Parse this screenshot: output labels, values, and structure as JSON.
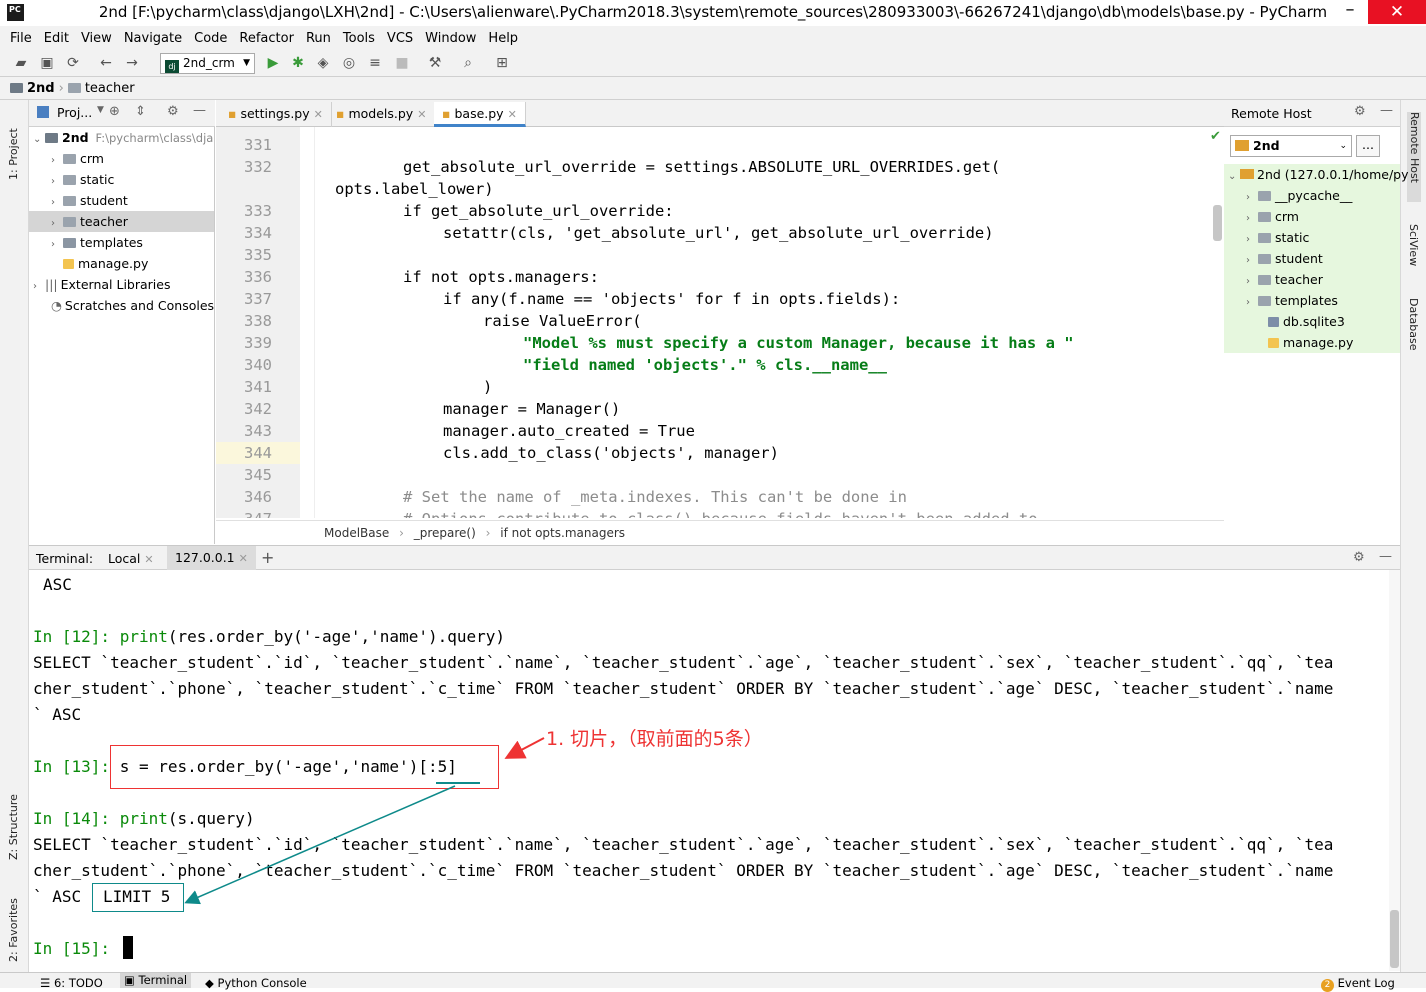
{
  "window": {
    "title": "2nd [F:\\pycharm\\class\\django\\LXH\\2nd] - C:\\Users\\alienware\\.PyCharm2018.3\\system\\remote_sources\\280933003\\-66267241\\django\\db\\models\\base.py - PyCharm",
    "app_icon_text": "PC"
  },
  "menu": [
    "File",
    "Edit",
    "View",
    "Navigate",
    "Code",
    "Refactor",
    "Run",
    "Tools",
    "VCS",
    "Window",
    "Help"
  ],
  "toolbar": {
    "run_config": "2nd_crm"
  },
  "navbar": {
    "project": "2nd",
    "folder": "teacher"
  },
  "left_stripe": {
    "project": "1: Project",
    "structure": "Z: Structure",
    "favorites": "2: Favorites"
  },
  "right_stripe": {
    "remote_host": "Remote Host",
    "sciview": "SciView",
    "database": "Database"
  },
  "project_panel": {
    "title": "Proj...",
    "root": {
      "name": "2nd",
      "path": "F:\\pycharm\\class\\dja"
    },
    "items": [
      {
        "name": "crm"
      },
      {
        "name": "static"
      },
      {
        "name": "student"
      },
      {
        "name": "teacher"
      },
      {
        "name": "templates"
      },
      {
        "name": "manage.py"
      }
    ],
    "external": "External Libraries",
    "scratches": "Scratches and Consoles"
  },
  "editor": {
    "tabs": [
      {
        "label": "settings.py"
      },
      {
        "label": "models.py"
      },
      {
        "label": "base.py"
      }
    ],
    "line_numbers": [
      "331",
      "332",
      "333",
      "334",
      "335",
      "336",
      "337",
      "338",
      "339",
      "340",
      "341",
      "342",
      "343",
      "344",
      "345",
      "346",
      "347"
    ],
    "code": {
      "l332": "get_absolute_url_override = settings.ABSOLUTE_URL_OVERRIDES.get(",
      "l332b": "opts.label_lower)",
      "l333": "if get_absolute_url_override:",
      "l334": "setattr(cls, 'get_absolute_url', get_absolute_url_override)",
      "l336": "if not opts.managers:",
      "l337": "if any(f.name == 'objects' for f in opts.fields):",
      "l338": "raise ValueError(",
      "l339": "\"Model %s must specify a custom Manager, because it has a \"",
      "l340": "\"field named 'objects'.\" % cls.__name__",
      "l341": ")",
      "l342": "manager = Manager()",
      "l343": "manager.auto_created = True",
      "l344": "cls.add_to_class('objects', manager)",
      "l346": "# Set the name of _meta.indexes. This can't be done in",
      "l347": "# Options.contribute_to_class() because fields haven't been added to"
    },
    "breadcrumb": [
      "ModelBase",
      "_prepare()",
      "if not opts.managers"
    ]
  },
  "remote_host": {
    "title": "Remote Host",
    "server": "2nd",
    "root": "2nd (127.0.0.1/home/py",
    "items": [
      {
        "name": "__pycache__"
      },
      {
        "name": "crm"
      },
      {
        "name": "static"
      },
      {
        "name": "student"
      },
      {
        "name": "teacher"
      },
      {
        "name": "templates"
      },
      {
        "name": "db.sqlite3"
      },
      {
        "name": "manage.py"
      }
    ]
  },
  "terminal": {
    "label": "Terminal:",
    "tabs": [
      {
        "label": "Local"
      },
      {
        "label": "127.0.0.1"
      }
    ],
    "lines": {
      "asc_top": "ASC",
      "in12_prompt": "In [12]: ",
      "in12_cmd": "(res.order_by('-age','name').query)",
      "sql1a": "SELECT `teacher_student`.`id`, `teacher_student`.`name`, `teacher_student`.`age`, `teacher_student`.`sex`, `teacher_student`.`qq`, `tea",
      "sql1b": "cher_student`.`phone`, `teacher_student`.`c_time` FROM `teacher_student` ORDER BY `teacher_student`.`age` DESC, `teacher_student`.`name",
      "sql1c": "` ASC",
      "in13_prompt": "In [13]: ",
      "in13_cmd": "s = res.order_by('-age','name')[:5]",
      "in14_prompt": "In [14]: ",
      "in14_cmd": "(s.query)",
      "sql2a": "SELECT `teacher_student`.`id`, `teacher_student`.`name`, `teacher_student`.`age`, `teacher_student`.`sex`, `teacher_student`.`qq`, `tea",
      "sql2b": "cher_student`.`phone`, `teacher_student`.`c_time` FROM `teacher_student` ORDER BY `teacher_student`.`age` DESC, `teacher_student`.`name",
      "sql2c": "` ASC",
      "limit": "LIMIT 5",
      "in15_prompt": "In [15]: "
    },
    "print_kw": "print"
  },
  "annotation": {
    "text": "1. 切片，（取前面的5条）"
  },
  "statusbar": {
    "todo": "6: TODO",
    "terminal": "Terminal",
    "python_console": "Python Console",
    "event_count": "2",
    "event_log": "Event Log"
  }
}
